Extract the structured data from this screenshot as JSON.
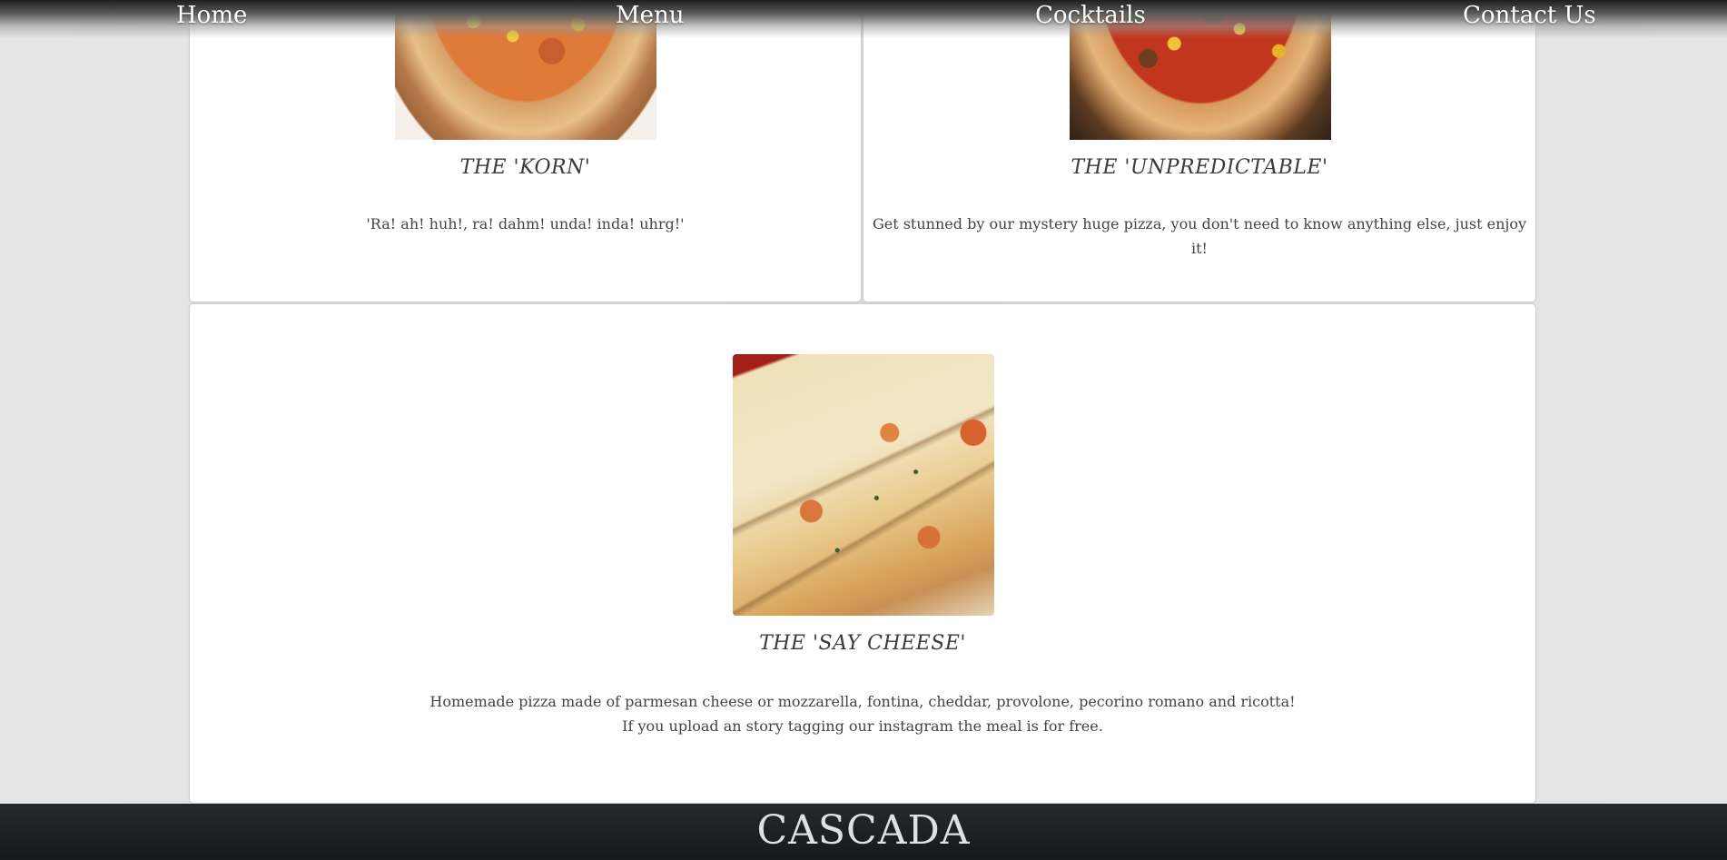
{
  "nav": {
    "items": [
      {
        "label": "Home"
      },
      {
        "label": "Menu"
      },
      {
        "label": "Cocktails"
      },
      {
        "label": "Contact Us"
      }
    ]
  },
  "menu_items": [
    {
      "title": "THE 'KORN'",
      "description": "'Ra! ah! huh!, ra! dahm! unda! inda! uhrg!'",
      "image": "pizza-korn-image"
    },
    {
      "title": "THE 'UNPREDICTABLE'",
      "description": "Get stunned by our mystery huge pizza, you don't need to know anything else, just enjoy it!",
      "image": "pizza-unpredictable-image"
    },
    {
      "title": "THE 'SAY CHEESE'",
      "description_line1": "Homemade pizza made of parmesan cheese or mozzarella, fontina, cheddar, provolone, pecorino romano and ricotta!",
      "description_line2": "If you upload an story tagging our instagram the meal is for free.",
      "image": "pizza-say-cheese-image"
    }
  ],
  "footer": {
    "brand": "CASCADA"
  }
}
